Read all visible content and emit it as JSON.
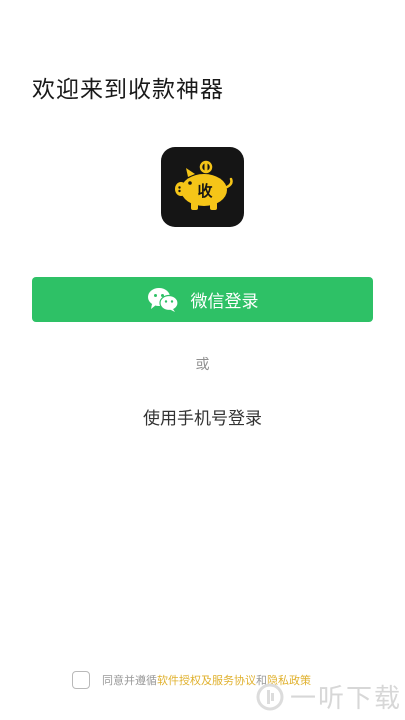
{
  "header": {
    "title": "欢迎来到收款神器"
  },
  "app_icon": {
    "glyph": "收",
    "accent": "#f5c518"
  },
  "login": {
    "wechat_label": "微信登录",
    "wechat_color": "#2ec166",
    "or_text": "或",
    "phone_label": "使用手机号登录"
  },
  "agreement": {
    "prefix": "同意并遵循",
    "link1": "软件授权及服务协议",
    "middle": "和",
    "link2": "隐私政策"
  },
  "watermark": {
    "text": "一听下载"
  }
}
